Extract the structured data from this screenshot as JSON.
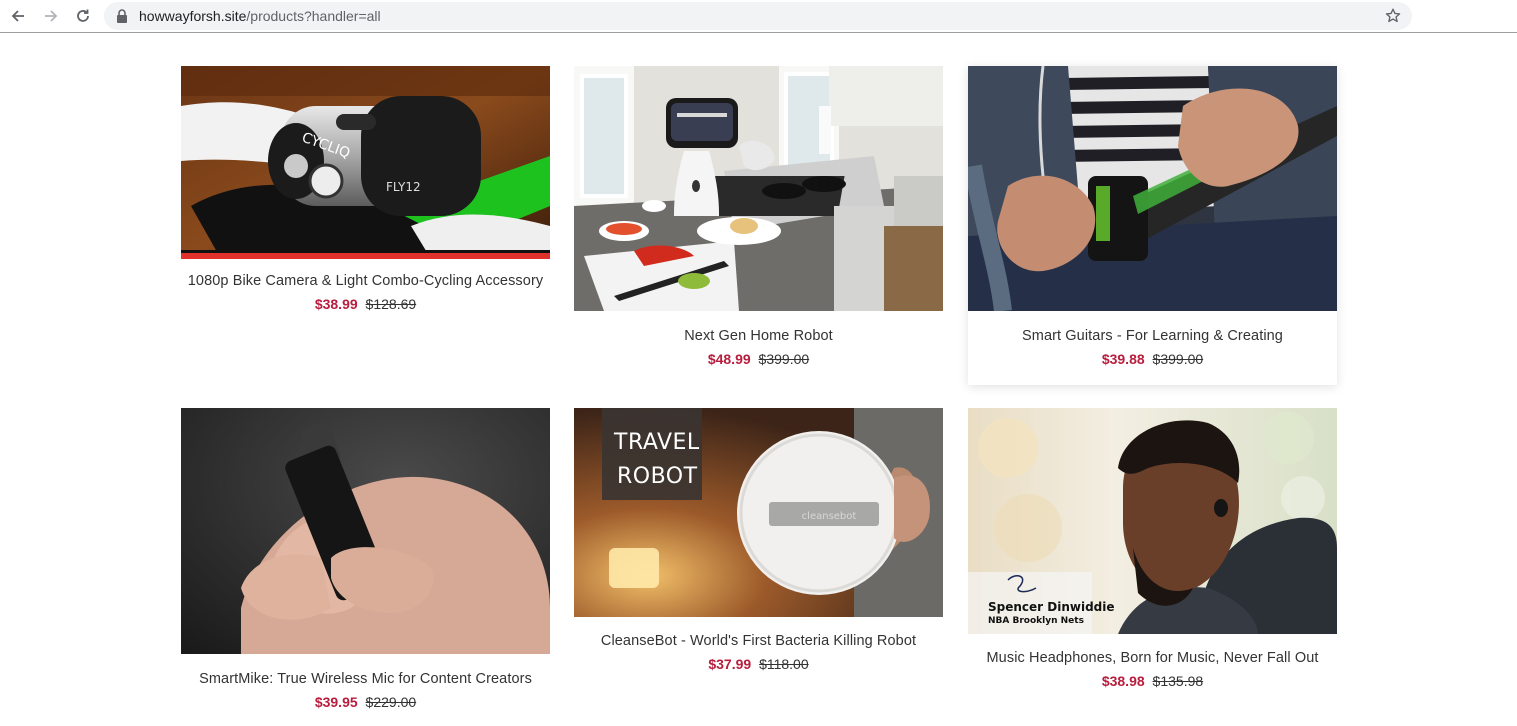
{
  "browser": {
    "url_host": "howwayforsh.site",
    "url_path": "/products?handler=all"
  },
  "colors": {
    "sale_price": "#b81d3e",
    "title_text": "#333333"
  },
  "products": [
    {
      "title": "1080p Bike Camera & Light Combo-Cycling Accessory",
      "sale_price": "$38.99",
      "old_price": "$128.69",
      "image_text": [
        "CYCLIQ",
        "FLY12"
      ]
    },
    {
      "title": "Next Gen Home Robot",
      "sale_price": "$48.99",
      "old_price": "$399.00"
    },
    {
      "title": "Smart Guitars - For Learning & Creating",
      "sale_price": "$39.88",
      "old_price": "$399.00"
    },
    {
      "title": "SmartMike: True Wireless Mic for Content Creators",
      "sale_price": "$39.95",
      "old_price": "$229.00"
    },
    {
      "title": "CleanseBot - World's First Bacteria Killing Robot",
      "sale_price": "$37.99",
      "old_price": "$118.00",
      "image_text": [
        "TRAVEL",
        "ROBOT",
        "cleansebot"
      ]
    },
    {
      "title": "Music Headphones, Born for Music, Never Fall Out",
      "sale_price": "$38.98",
      "old_price": "$135.98",
      "image_text": [
        "Spencer Dinwiddie",
        "NBA Brooklyn Nets"
      ]
    }
  ]
}
